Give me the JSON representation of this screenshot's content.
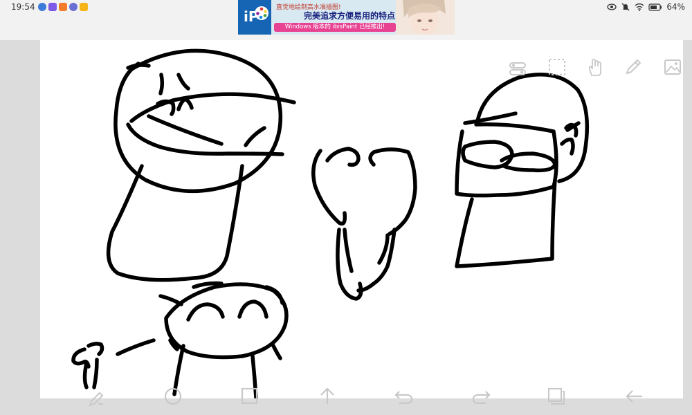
{
  "status_bar": {
    "time": "19:54",
    "battery": "64%",
    "notification_icons": [
      "app-icon-blue",
      "app-icon-pink",
      "app-icon-orange",
      "app-icon-purple",
      "app-icon-yellow"
    ]
  },
  "ad_banner": {
    "logo": "iP",
    "line1": "直觉地绘制高水准插图!",
    "line2": "完美追求方便易用的特点!",
    "line3": "Windows 版本的 ibisPaint 已经推出!"
  },
  "canvas_tools": [
    "layers-toggle-icon",
    "selection-icon",
    "hand-icon",
    "pen-icon",
    "image-icon"
  ],
  "bottom_toolbar": [
    "pen-settings-icon",
    "circle-icon",
    "square-icon",
    "up-arrow-icon",
    "undo-icon",
    "redo-icon",
    "layers-icon",
    "back-arrow-icon"
  ],
  "colors": {
    "ink": "#000000",
    "canvas": "#ffffff",
    "frame": "#dcdcdc",
    "toolbar_icons": "#c8c8c8"
  }
}
